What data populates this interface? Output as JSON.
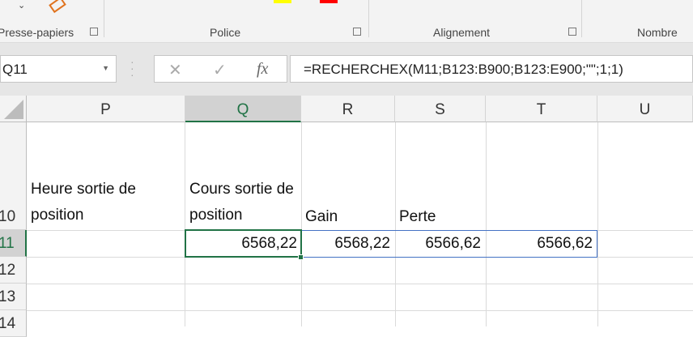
{
  "ribbon": {
    "groups": [
      "Presse-papiers",
      "Police",
      "Alignement",
      "Nombre"
    ],
    "colors": {
      "highlight": "#ffff00",
      "font": "#ff0000"
    }
  },
  "formula_bar": {
    "name_box": "Q11",
    "formula": "=RECHERCHEX(M11;B123:B900;B123:E900;\"\";1;1)",
    "cancel": "✕",
    "enter": "✓",
    "fx": "fx"
  },
  "columns": [
    "P",
    "Q",
    "R",
    "S",
    "T",
    "U"
  ],
  "rows": [
    "10",
    "11",
    "12",
    "13",
    "14"
  ],
  "cells": {
    "P10": "Heure sortie de position",
    "Q10": "Cours sortie de position",
    "R10": "Gain",
    "S10": "Perte",
    "Q11": "6568,22",
    "R11": "6568,22",
    "S11": "6566,62",
    "T11": "6566,62"
  }
}
